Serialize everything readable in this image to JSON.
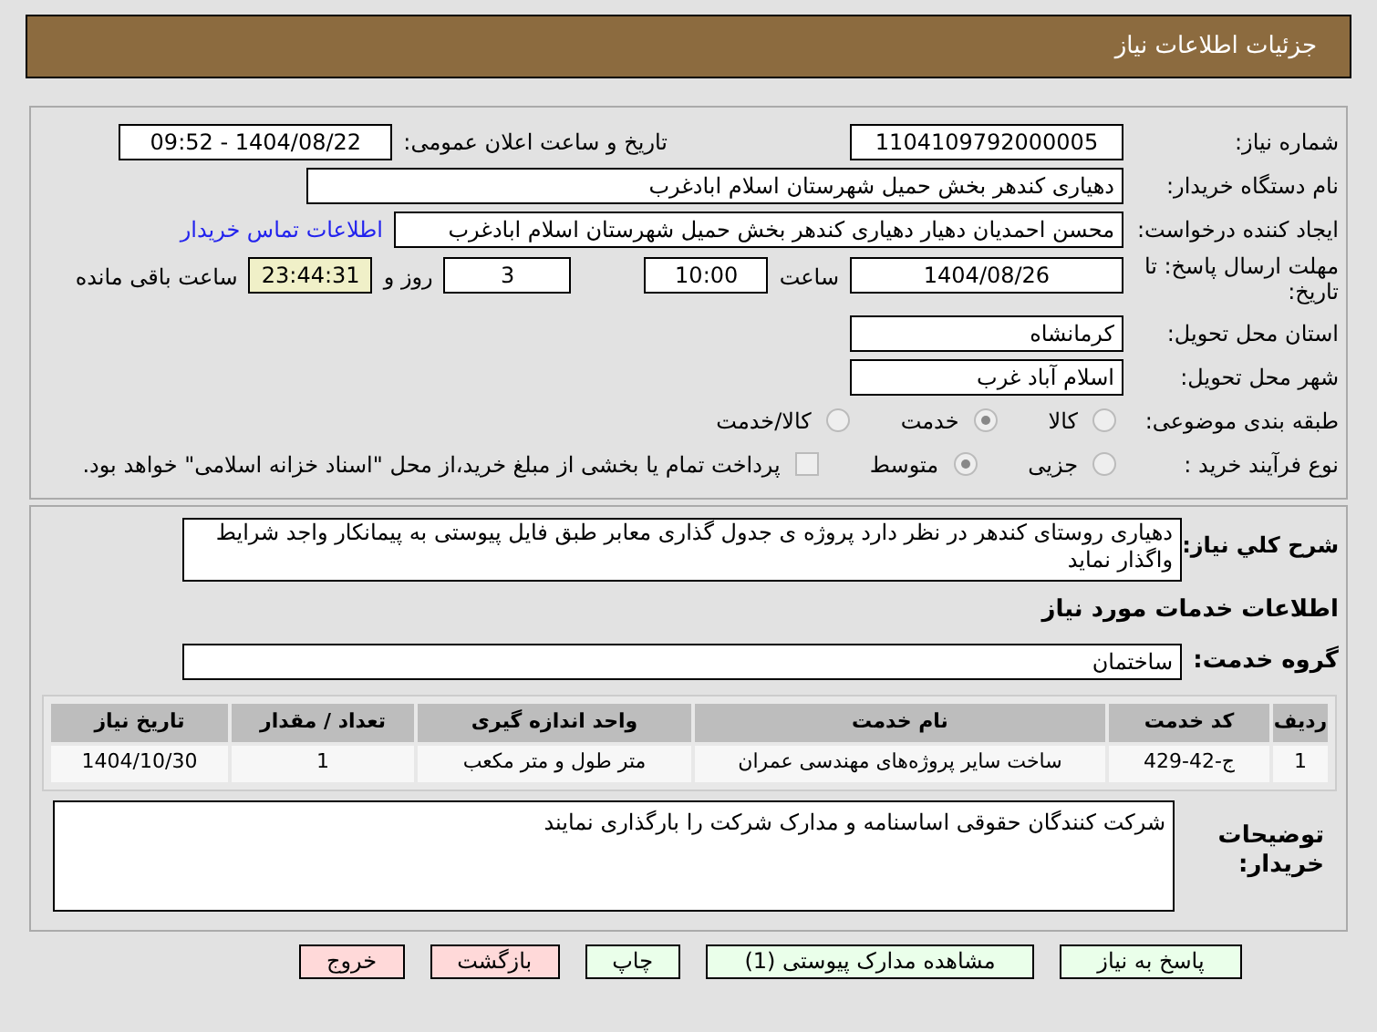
{
  "header": {
    "title": "جزئیات اطلاعات نیاز"
  },
  "need_number": {
    "label": "شماره نیاز:",
    "value": "1104109792000005"
  },
  "announce": {
    "label": "تاریخ و ساعت اعلان عمومی:",
    "value": "1404/08/22 - 09:52"
  },
  "buyer_org": {
    "label": "نام دستگاه خریدار:",
    "value": "دهیاری کندهر بخش حمیل شهرستان اسلام ابادغرب"
  },
  "creator": {
    "label": "ایجاد کننده درخواست:",
    "value": "محسن احمدیان دهیار دهیاری کندهر بخش حمیل شهرستان اسلام ابادغرب",
    "link": "اطلاعات تماس خریدار"
  },
  "deadline": {
    "label": "مهلت ارسال پاسخ: تا تاریخ:",
    "date": "1404/08/26",
    "time_label": "ساعت",
    "time": "10:00",
    "days": "3",
    "days_label": "روز و",
    "remaining": "23:44:31",
    "remaining_label": "ساعت باقی مانده"
  },
  "province": {
    "label": "استان محل تحویل:",
    "value": "کرمانشاه"
  },
  "city": {
    "label": "شهر محل تحویل:",
    "value": "اسلام آباد غرب"
  },
  "category": {
    "label": "طبقه بندی موضوعی:",
    "options": [
      {
        "label": "کالا",
        "selected": false
      },
      {
        "label": "خدمت",
        "selected": true
      },
      {
        "label": "کالا/خدمت",
        "selected": false
      }
    ]
  },
  "process": {
    "label": "نوع فرآیند خرید :",
    "options": [
      {
        "label": "جزیی",
        "selected": false
      },
      {
        "label": "متوسط",
        "selected": true
      }
    ],
    "checkbox": {
      "checked": false,
      "label": "پرداخت تمام یا بخشی از مبلغ خرید،از محل \"اسناد خزانه اسلامی\" خواهد بود."
    }
  },
  "description": {
    "label": "شرح کلي نیاز:",
    "value": "دهیاری روستای کندهر در نظر دارد پروژه ی جدول گذاری معابر طبق فایل پیوستی به پیمانکار واجد شرایط واگذار نماید"
  },
  "services_title": "اطلاعات خدمات مورد نیاز",
  "service_group": {
    "label": "گروه خدمت:",
    "value": "ساختمان"
  },
  "table": {
    "columns": [
      "ردیف",
      "کد خدمت",
      "نام خدمت",
      "واحد اندازه گیری",
      "تعداد / مقدار",
      "تاریخ نیاز"
    ],
    "rows": [
      [
        "1",
        "ج-42-429",
        "ساخت سایر پروژه‌های مهندسی عمران",
        "متر طول و متر مکعب",
        "1",
        "1404/10/30"
      ]
    ]
  },
  "buyer_notes": {
    "label": "توضیحات خریدار:",
    "value": "شرکت کنندگان حقوقی اساسنامه و مدارک شرکت را بارگذاری نمایند"
  },
  "buttons": [
    {
      "label": "پاسخ به نیاز",
      "kind": "green"
    },
    {
      "label": "مشاهده مدارک پیوستی (1)",
      "kind": "green"
    },
    {
      "label": "چاپ",
      "kind": "green"
    },
    {
      "label": "بازگشت",
      "kind": "pink"
    },
    {
      "label": "خروج",
      "kind": "pink"
    }
  ]
}
